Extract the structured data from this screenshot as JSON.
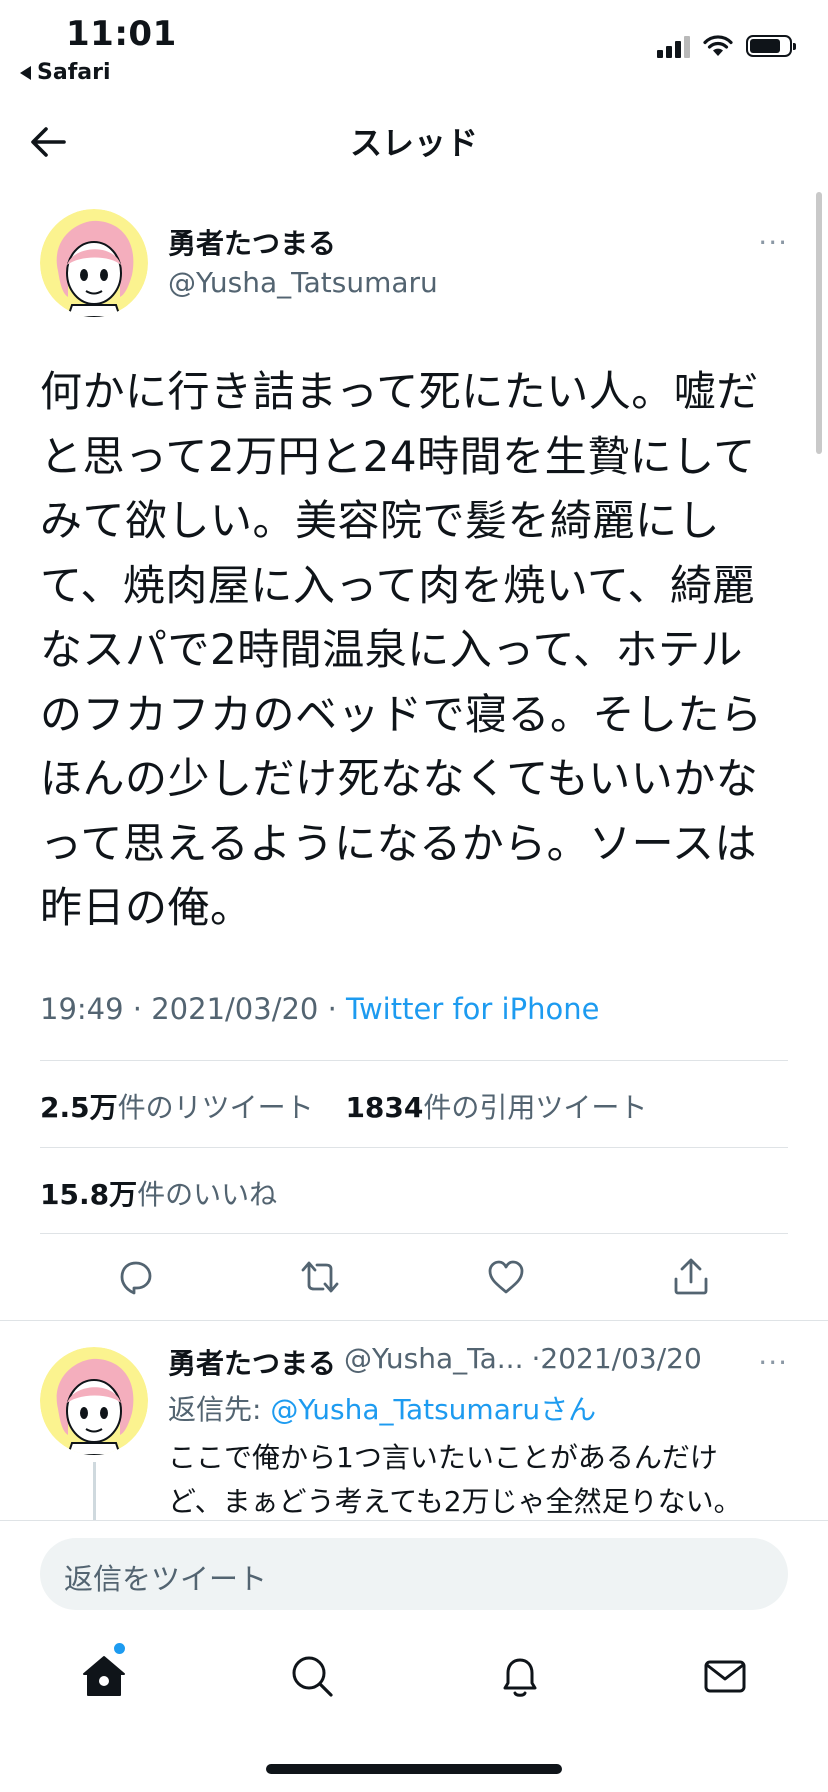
{
  "status_bar": {
    "time": "11:01",
    "back_app": "Safari"
  },
  "header": {
    "title": "スレッド"
  },
  "tweet": {
    "display_name": "勇者たつまる",
    "handle": "@Yusha_Tatsumaru",
    "more": "···",
    "text": "何かに行き詰まって死にたい人。嘘だ\nと思って2万円と24時間を生贄にして\nみて欲しい。美容院で髪を綺麗にし\nて、焼肉屋に入って肉を焼いて、綺麗\nなスパで2時間温泉に入って、ホテル\nのフカフカのベッドで寝る。そしたら\nほんの少しだけ死ななくてもいいかな\nって思えるようになるから。ソースは\n昨日の俺。",
    "time": "19:49",
    "sep": " · ",
    "date": "2021/03/20",
    "source": "Twitter for iPhone",
    "retweets_value": "2.5万",
    "retweets_label": "件のリツイート",
    "quotes_value": "1834",
    "quotes_label": "件の引用ツイート",
    "likes_value": "15.8万",
    "likes_label": "件のいいね"
  },
  "reply": {
    "display_name": "勇者たつまる",
    "handle": "@Yusha_Ta...",
    "date": "·2021/03/20",
    "more": "···",
    "reply_to_label": "返信先: ",
    "reply_to_handle": "@Yusha_Tatsumaruさん",
    "text": "ここで俺から1つ言いたいことがあるんだけど、まぁどう考えても2万じゃ全然足りない。"
  },
  "compose": {
    "placeholder": "返信をツイート"
  },
  "colors": {
    "accent": "#1d9bf0",
    "text": "#0f1419",
    "secondary": "#536471"
  }
}
